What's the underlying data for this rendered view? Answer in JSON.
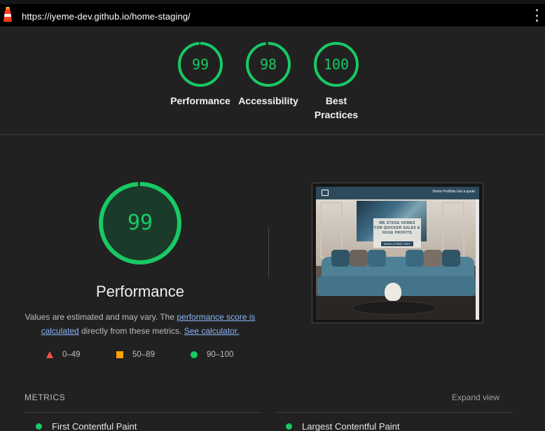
{
  "topbar": {
    "url": "https://iyeme-dev.github.io/home-staging/"
  },
  "summary_scores": [
    {
      "value": "99",
      "label": "Performance",
      "score": 99
    },
    {
      "value": "98",
      "label": "Accessibility",
      "score": 98
    },
    {
      "value": "100",
      "label": "Best Practices",
      "label_line1": "Best",
      "label_line2": "Practices",
      "score": 100
    }
  ],
  "performance": {
    "score": "99",
    "score_value": 99,
    "title": "Performance",
    "desc_prefix": "Values are estimated and may vary. The ",
    "desc_link1": "performance score is calculated",
    "desc_middle": " directly from these metrics. ",
    "desc_link2": "See calculator."
  },
  "legend": [
    {
      "range": "0–49",
      "shape": "triangle",
      "color": "#ff4e42"
    },
    {
      "range": "50–89",
      "shape": "square",
      "color": "#ffa400"
    },
    {
      "range": "90–100",
      "shape": "circle",
      "color": "#18c964"
    }
  ],
  "screenshot": {
    "nav_links": "Home   Portfolio   Get a quote",
    "hero_line1": "WE STAGE HOMES",
    "hero_line2": "FOR QUICKER SALES &",
    "hero_line3": "HUGE PROFITS",
    "hero_button": "BOOK A FREE VISIT"
  },
  "metrics": {
    "title": "METRICS",
    "expand_label": "Expand view",
    "items": [
      {
        "name": "First Contentful Paint"
      },
      {
        "name": "Largest Contentful Paint"
      }
    ]
  },
  "colors": {
    "pass": "#18c964",
    "average": "#ffa400",
    "fail": "#ff4e42",
    "background": "#212121"
  }
}
